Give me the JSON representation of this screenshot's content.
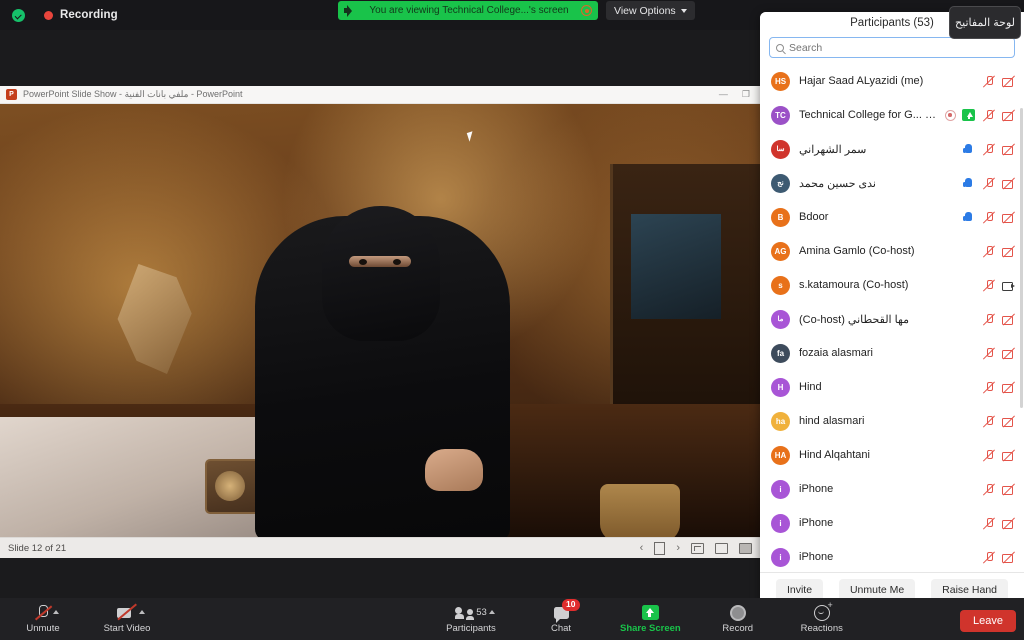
{
  "topbar": {
    "recording_label": "Recording",
    "shield_icon": "security-shield-icon",
    "share_banner_text": "You are viewing Technical College...'s screen",
    "view_options_label": "View Options",
    "keyboard_tooltip": "لوحة المفاتيح"
  },
  "shared_window": {
    "title": "PowerPoint Slide Show  -  ملفي بانات الفنية - PowerPoint",
    "logo_letter": "P",
    "minimize": "—",
    "restore": "❐",
    "status_slide": "Slide 12 of 21",
    "nav_prev": "‹",
    "nav_next": "›"
  },
  "panel": {
    "title": "Participants (53)",
    "search_placeholder": "Search",
    "search_value": "",
    "footer": {
      "invite": "Invite",
      "unmute_me": "Unmute Me",
      "raise_hand": "Raise Hand"
    },
    "participants": [
      {
        "initials": "HS",
        "color": "#e8711a",
        "name": "Hajar Saad ALyazidi (me)",
        "rtl": false,
        "hand": false,
        "recdot": false,
        "sharing": false,
        "mic": "muted",
        "video": "off"
      },
      {
        "initials": "TC",
        "color": "#9b51c7",
        "name": "Technical College for G... (Host)",
        "rtl": false,
        "hand": false,
        "recdot": true,
        "sharing": true,
        "mic": "muted",
        "video": "off"
      },
      {
        "initials": "سا",
        "color": "#d0342c",
        "name": "سمر الشهراني",
        "rtl": true,
        "hand": true,
        "recdot": false,
        "sharing": false,
        "mic": "muted",
        "video": "off"
      },
      {
        "initials": "نج",
        "color": "#3d5a72",
        "name": "ندى حسين محمد",
        "rtl": true,
        "hand": true,
        "recdot": false,
        "sharing": false,
        "mic": "muted",
        "video": "off"
      },
      {
        "initials": "B",
        "color": "#e8711a",
        "name": "Bdoor",
        "rtl": false,
        "hand": true,
        "recdot": false,
        "sharing": false,
        "mic": "muted",
        "video": "off"
      },
      {
        "initials": "AG",
        "color": "#e8711a",
        "name": "Amina Gamlo (Co-host)",
        "rtl": false,
        "hand": false,
        "recdot": false,
        "sharing": false,
        "mic": "muted",
        "video": "off"
      },
      {
        "initials": "s",
        "color": "#e8711a",
        "name": "s.katamoura (Co-host)",
        "rtl": false,
        "hand": false,
        "recdot": false,
        "sharing": false,
        "mic": "muted",
        "video": "on"
      },
      {
        "initials": "ما",
        "color": "#a855d6",
        "name": "مها القحطاني (Co-host)",
        "rtl": true,
        "hand": false,
        "recdot": false,
        "sharing": false,
        "mic": "muted",
        "video": "off"
      },
      {
        "initials": "fa",
        "color": "#3d4b5c",
        "name": "fozaia alasmari",
        "rtl": false,
        "hand": false,
        "recdot": false,
        "sharing": false,
        "mic": "muted",
        "video": "off"
      },
      {
        "initials": "H",
        "color": "#a855d6",
        "name": "Hind",
        "rtl": false,
        "hand": false,
        "recdot": false,
        "sharing": false,
        "mic": "muted",
        "video": "off"
      },
      {
        "initials": "ha",
        "color": "#f0b13b",
        "name": "hind alasmari",
        "rtl": false,
        "hand": false,
        "recdot": false,
        "sharing": false,
        "mic": "muted",
        "video": "off"
      },
      {
        "initials": "HA",
        "color": "#e8711a",
        "name": "Hind Alqahtani",
        "rtl": false,
        "hand": false,
        "recdot": false,
        "sharing": false,
        "mic": "muted",
        "video": "off"
      },
      {
        "initials": "i",
        "color": "#a855d6",
        "name": "iPhone",
        "rtl": false,
        "hand": false,
        "recdot": false,
        "sharing": false,
        "mic": "muted",
        "video": "off"
      },
      {
        "initials": "i",
        "color": "#a855d6",
        "name": "iPhone",
        "rtl": false,
        "hand": false,
        "recdot": false,
        "sharing": false,
        "mic": "muted",
        "video": "off"
      },
      {
        "initials": "i",
        "color": "#a855d6",
        "name": "iPhone",
        "rtl": false,
        "hand": false,
        "recdot": false,
        "sharing": false,
        "mic": "muted",
        "video": "off"
      }
    ]
  },
  "toolbar": {
    "unmute_label": "Unmute",
    "start_video_label": "Start Video",
    "participants_label": "Participants",
    "participants_count": "53",
    "chat_label": "Chat",
    "chat_badge": "10",
    "share_screen_label": "Share Screen",
    "record_label": "Record",
    "reactions_label": "Reactions",
    "leave_label": "Leave"
  },
  "colors": {
    "accent_green": "#19c34a",
    "danger_red": "#d0342c",
    "badge_red": "#e02d2d",
    "hand_blue": "#2c7be5"
  }
}
